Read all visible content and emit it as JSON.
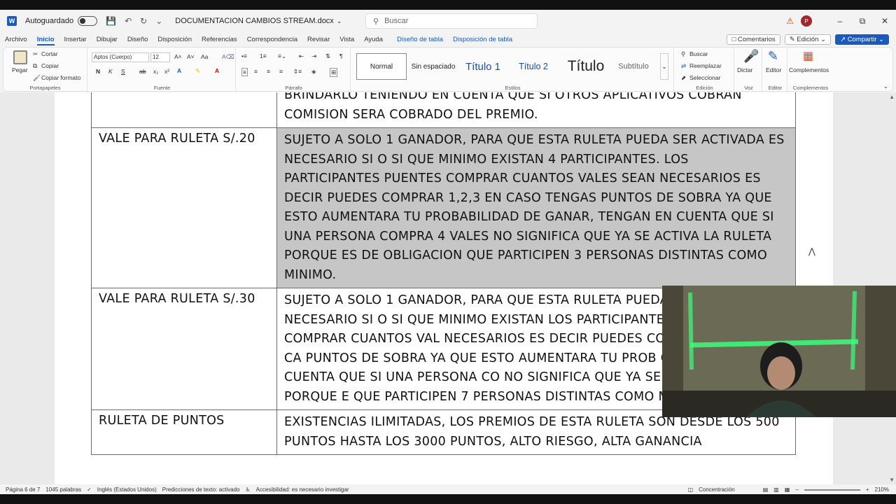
{
  "titlebar": {
    "autosave_label": "Autoguardado",
    "document_name": "DOCUMENTACION CAMBIOS STREAM.docx",
    "search_placeholder": "Buscar",
    "avatar_initial": "P"
  },
  "tabs": [
    {
      "label": "Archivo",
      "active": false
    },
    {
      "label": "Inicio",
      "active": true
    },
    {
      "label": "Insertar",
      "active": false
    },
    {
      "label": "Dibujar",
      "active": false
    },
    {
      "label": "Diseño",
      "active": false
    },
    {
      "label": "Disposición",
      "active": false
    },
    {
      "label": "Referencias",
      "active": false
    },
    {
      "label": "Correspondencia",
      "active": false
    },
    {
      "label": "Revisar",
      "active": false
    },
    {
      "label": "Vista",
      "active": false
    },
    {
      "label": "Ayuda",
      "active": false
    },
    {
      "label": "Diseño de tabla",
      "active": false,
      "context": true
    },
    {
      "label": "Disposición de tabla",
      "active": false,
      "context": true
    }
  ],
  "tabs_right": {
    "comments": "Comentarios",
    "editing": "Edición",
    "share": "Compartir"
  },
  "ribbon": {
    "clipboard": {
      "paste": "Pegar",
      "cut": "Cortar",
      "copy": "Copiar",
      "format_painter": "Copiar formato",
      "label": "Portapapeles"
    },
    "font": {
      "name": "Aptos (Cuerpo)",
      "size": "12",
      "bold": "N",
      "italic": "K",
      "underline": "S",
      "label": "Fuente"
    },
    "paragraph": {
      "label": "Párrafo"
    },
    "styles": {
      "items": [
        "Normal",
        "Sin espaciado",
        "Título 1",
        "Título 2",
        "Título",
        "Subtítulo"
      ],
      "label": "Estilos"
    },
    "editing": {
      "find": "Buscar",
      "replace": "Reemplazar",
      "select": "Seleccionar",
      "label": "Edición"
    },
    "voice": {
      "dictate": "Dictar",
      "label": "Voz"
    },
    "editor": {
      "editor": "Editor",
      "label": "Editor"
    },
    "addins": {
      "addins": "Complementos",
      "label": "Complementos"
    }
  },
  "table": {
    "rows": [
      {
        "name": "",
        "desc": "BRINDARLO TENIENDO EN CUENTA QUE SI OTROS APLICATIVOS COBRAN COMISION SERA COBRADO DEL PREMIO.",
        "selected": false
      },
      {
        "name": "VALE PARA RULETA S/.20",
        "desc": "SUJETO A SOLO 1 GANADOR, PARA QUE ESTA RULETA PUEDA SER ACTIVADA ES NECESARIO SI O SI QUE MINIMO EXISTAN 4 PARTICIPANTES. LOS PARTICIPANTES PUENTES COMPRAR CUANTOS VALES SEAN NECESARIOS ES DECIR PUEDES COMPRAR 1,2,3 EN CASO TENGAS PUNTOS DE SOBRA YA QUE ESTO AUMENTARA TU PROBABILIDAD DE GANAR, TENGAN EN CUENTA QUE SI UNA PERSONA COMPRA 4 VALES NO SIGNIFICA QUE YA SE ACTIVA LA RULETA PORQUE ES DE OBLIGACION QUE PARTICIPEN 3 PERSONAS DISTINTAS COMO MINIMO.",
        "selected": true
      },
      {
        "name": "VALE PARA RULETA S/.30",
        "desc": "SUJETO A SOLO 1 GANADOR, PARA QUE ESTA RULETA PUEDA SER ACTIVADA ES NECESARIO SI O SI QUE MINIMO EXISTAN LOS PARTICIPANTES PUENTES COMPRAR CUANTOS VAL NECESARIOS ES DECIR PUEDES COMPRAR 1,2,3 EN CA PUNTOS DE SOBRA YA QUE ESTO AUMENTARA TU PROB GANAR, TENGAN EN CUENTA QUE SI UNA PERSONA CO NO SIGNIFICA QUE YA SE ACTIVA LA RULETA PORQUE E QUE PARTICIPEN 7 PERSONAS DISTINTAS COMO MINIMO.",
        "selected": false
      },
      {
        "name": "RULETA DE PUNTOS",
        "desc": "EXISTENCIAS ILIMITADAS, LOS PREMIOS DE ESTA RULETA SON DESDE LOS 500 PUNTOS HASTA LOS 3000 PUNTOS, ALTO RIESGO, ALTA GANANCIA",
        "selected": false
      }
    ]
  },
  "statusbar": {
    "page": "Página 6 de 7",
    "words": "1045 palabras",
    "language": "Inglés (Estados Unidos)",
    "predictions": "Predicciones de texto: activado",
    "accessibility": "Accesibilidad: es necesario investigar",
    "focus": "Concentración",
    "zoom": "210%"
  },
  "colors": {
    "accent": "#185abd",
    "selection": "#c6c6c6",
    "warning": "#d83b01"
  }
}
